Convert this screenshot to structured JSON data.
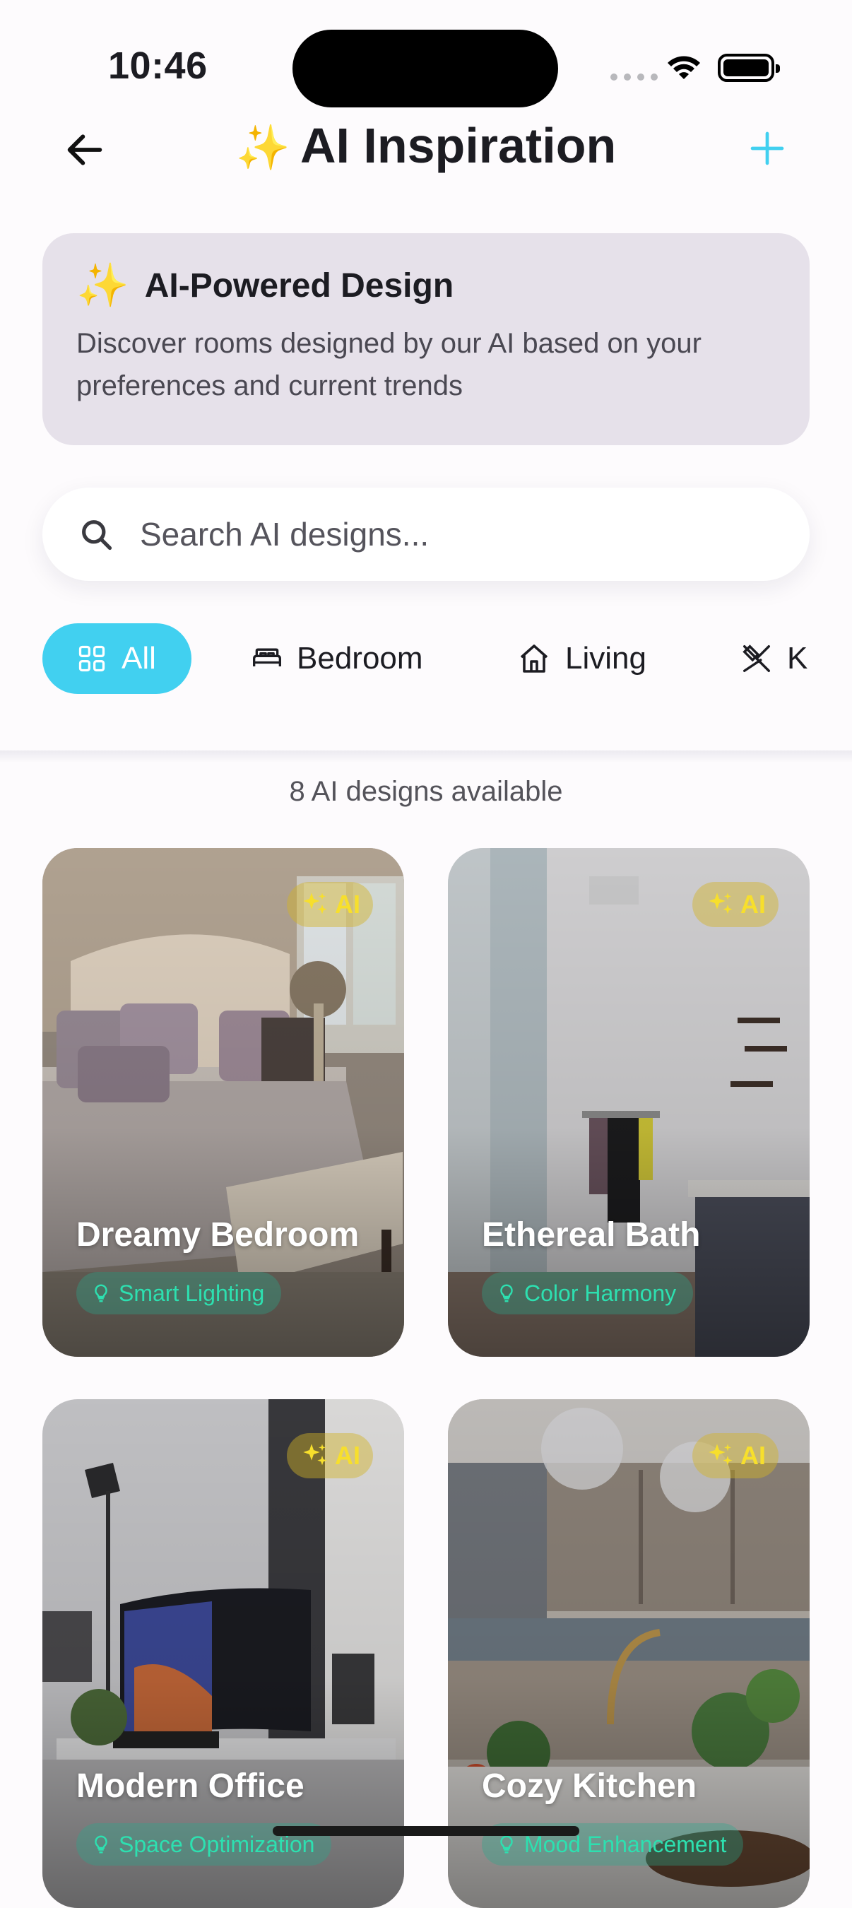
{
  "status": {
    "time": "10:46"
  },
  "nav": {
    "title": "AI Inspiration",
    "title_emoji": "✨"
  },
  "ai_card": {
    "emoji": "✨",
    "title": "AI-Powered Design",
    "description": "Discover rooms designed by our AI based on your preferences and current trends"
  },
  "search": {
    "placeholder": "Search AI designs..."
  },
  "filters": [
    {
      "label": "All",
      "icon": "grid-icon",
      "active": true
    },
    {
      "label": "Bedroom",
      "icon": "bed-icon",
      "active": false
    },
    {
      "label": "Living",
      "icon": "house-icon",
      "active": false
    },
    {
      "label": "K",
      "icon": "utensils-icon",
      "active": false
    }
  ],
  "results_count": "8 AI designs available",
  "badge_label": "AI",
  "designs": [
    {
      "title": "Dreamy Bedroom",
      "feature": "Smart Lighting"
    },
    {
      "title": "Ethereal Bath",
      "feature": "Color Harmony"
    },
    {
      "title": "Modern Office",
      "feature": "Space Optimization"
    },
    {
      "title": "Cozy Kitchen",
      "feature": "Mood Enhancement"
    }
  ],
  "colors": {
    "accent": "#41d0f0",
    "badge_text": "#f7df2c",
    "feature_text": "#2de0b0"
  }
}
